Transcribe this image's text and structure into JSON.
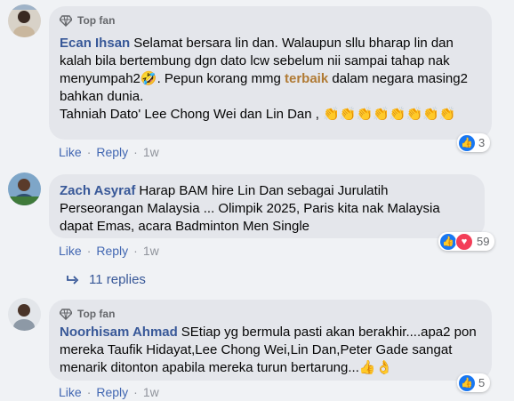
{
  "comments": [
    {
      "badge": "Top fan",
      "author": "Ecan Ihsan",
      "text_a": "Selamat bersara lin dan. Walaupun sllu bharap lin dan kalah bila bertembung dgn dato lcw sebelum nii sampai tahap nak menyumpah2",
      "emoji_a": "🤣",
      "text_b": ". Pepun korang mmg ",
      "highlight": "terbaik",
      "text_c": " dalam negara masing2 bahkan dunia.",
      "text_d": "Tahniah Dato' Lee Chong Wei dan Lin Dan ,",
      "emoji_d": "👏👏👏👏👏👏👏👏",
      "like": "Like",
      "reply": "Reply",
      "time": "1w",
      "reaction_count": "3"
    },
    {
      "author": "Zach Asyraf",
      "text": "Harap BAM hire Lin Dan sebagai Jurulatih Perseorangan Malaysia ... Olimpik 2025, Paris kita nak Malaysia dapat Emas, acara Badminton Men Single",
      "like": "Like",
      "reply": "Reply",
      "time": "1w",
      "reaction_count": "59",
      "replies_label": "11 replies"
    },
    {
      "badge": "Top fan",
      "author": "Noorhisam Ahmad",
      "text": "SEtiap yg bermula pasti akan berakhir....apa2 pon mereka Taufik Hidayat,Lee Chong Wei,Lin Dan,Peter Gade sangat menarik ditonton apabila mereka turun bertarung...",
      "emoji": "👍👌",
      "like": "Like",
      "reply": "Reply",
      "time": "1w",
      "reaction_count": "5"
    }
  ],
  "colors": {
    "author": "#385898",
    "highlight": "#b07a34",
    "like_blue": "#1877f2",
    "love_red": "#f33e58"
  },
  "icons": [
    "top-fan-diamond-icon",
    "like-icon",
    "love-icon",
    "reply-arrow-icon"
  ]
}
